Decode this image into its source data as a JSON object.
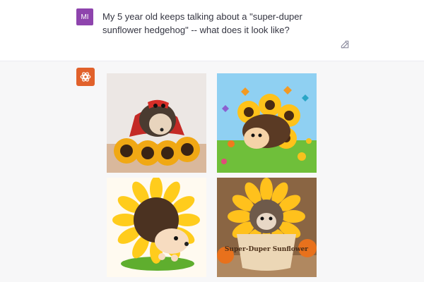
{
  "user_message": {
    "avatar_initials": "MI",
    "text": "My 5 year old keeps talking about a \"super-duper sunflower hedgehog\" -- what does it look like?"
  },
  "assistant": {
    "avatar_icon": "openai-logo-icon",
    "images": [
      {
        "name": "hedgehog-with-red-mask-and-cape"
      },
      {
        "name": "cartoon-hedgehog-in-sunflower-field"
      },
      {
        "name": "hedgehog-with-sunflower-mane"
      },
      {
        "name": "hedgehog-in-sunflower-pot",
        "pot_text": "Super-Duper Sunflower"
      }
    ]
  },
  "colors": {
    "user_avatar": "#8e44ad",
    "assistant_avatar": "#e1612b",
    "background": "#f7f7f8"
  }
}
